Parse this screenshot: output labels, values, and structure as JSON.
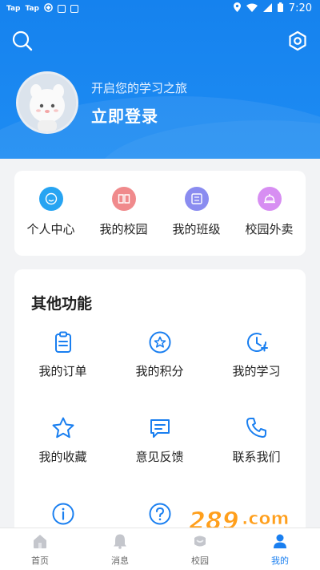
{
  "status_bar": {
    "left_items": [
      "Tap",
      "Tap"
    ],
    "time": "7:20"
  },
  "header": {
    "greeting": "开启您的学习之旅",
    "login_label": "立即登录"
  },
  "quick_menu": [
    {
      "label": "个人中心",
      "icon": "person-circle-icon",
      "color": "#27a4f2"
    },
    {
      "label": "我的校园",
      "icon": "book-icon",
      "color": "#f08a8c"
    },
    {
      "label": "我的班级",
      "icon": "class-icon",
      "color": "#8a8cf0"
    },
    {
      "label": "校园外卖",
      "icon": "food-cloche-icon",
      "color": "#d78ef2"
    }
  ],
  "other_functions": {
    "title": "其他功能",
    "items": [
      {
        "label": "我的订单",
        "icon": "clipboard-icon"
      },
      {
        "label": "我的积分",
        "icon": "star-badge-icon"
      },
      {
        "label": "我的学习",
        "icon": "clock-icon"
      },
      {
        "label": "我的收藏",
        "icon": "star-icon"
      },
      {
        "label": "意见反馈",
        "icon": "feedback-icon"
      },
      {
        "label": "联系我们",
        "icon": "phone-icon"
      },
      {
        "label": "",
        "icon": "info-icon"
      },
      {
        "label": "",
        "icon": "help-icon"
      }
    ]
  },
  "tab_bar": {
    "tabs": [
      {
        "label": "首页",
        "icon": "home-icon"
      },
      {
        "label": "消息",
        "icon": "bell-icon"
      },
      {
        "label": "校园",
        "icon": "campus-icon"
      },
      {
        "label": "我的",
        "icon": "user-icon"
      }
    ],
    "active_tab": "我的"
  },
  "watermark": {
    "text": "289.com",
    "subtext": "手游网"
  },
  "colors": {
    "primary": "#1a7ff0",
    "header_bg": "#1582ee",
    "page_bg": "#f2f3f5"
  }
}
